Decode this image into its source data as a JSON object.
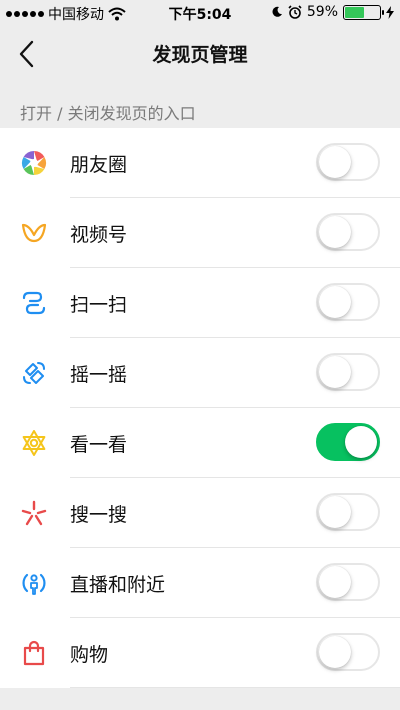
{
  "status_bar": {
    "carrier": "中国移动",
    "time": "下午5:04",
    "battery_percent": "59%",
    "battery_level": 0.59,
    "wifi_icon": "wifi-icon",
    "moon_icon": "moon-icon",
    "alarm_icon": "alarm-icon",
    "charging_icon": "charging-icon"
  },
  "nav": {
    "title": "发现页管理",
    "back_icon": "back-chevron-icon"
  },
  "section_label": "打开 / 关闭发现页的入口",
  "colors": {
    "toggle_on": "#07c160",
    "background": "#ededed"
  },
  "items": [
    {
      "label": "朋友圈",
      "icon": "moments-icon",
      "enabled": false
    },
    {
      "label": "视频号",
      "icon": "channels-icon",
      "enabled": false
    },
    {
      "label": "扫一扫",
      "icon": "scan-icon",
      "enabled": false
    },
    {
      "label": "摇一摇",
      "icon": "shake-icon",
      "enabled": false
    },
    {
      "label": "看一看",
      "icon": "top-stories-icon",
      "enabled": true
    },
    {
      "label": "搜一搜",
      "icon": "search-icon",
      "enabled": false
    },
    {
      "label": "直播和附近",
      "icon": "live-nearby-icon",
      "enabled": false
    },
    {
      "label": "购物",
      "icon": "shopping-icon",
      "enabled": false
    }
  ]
}
